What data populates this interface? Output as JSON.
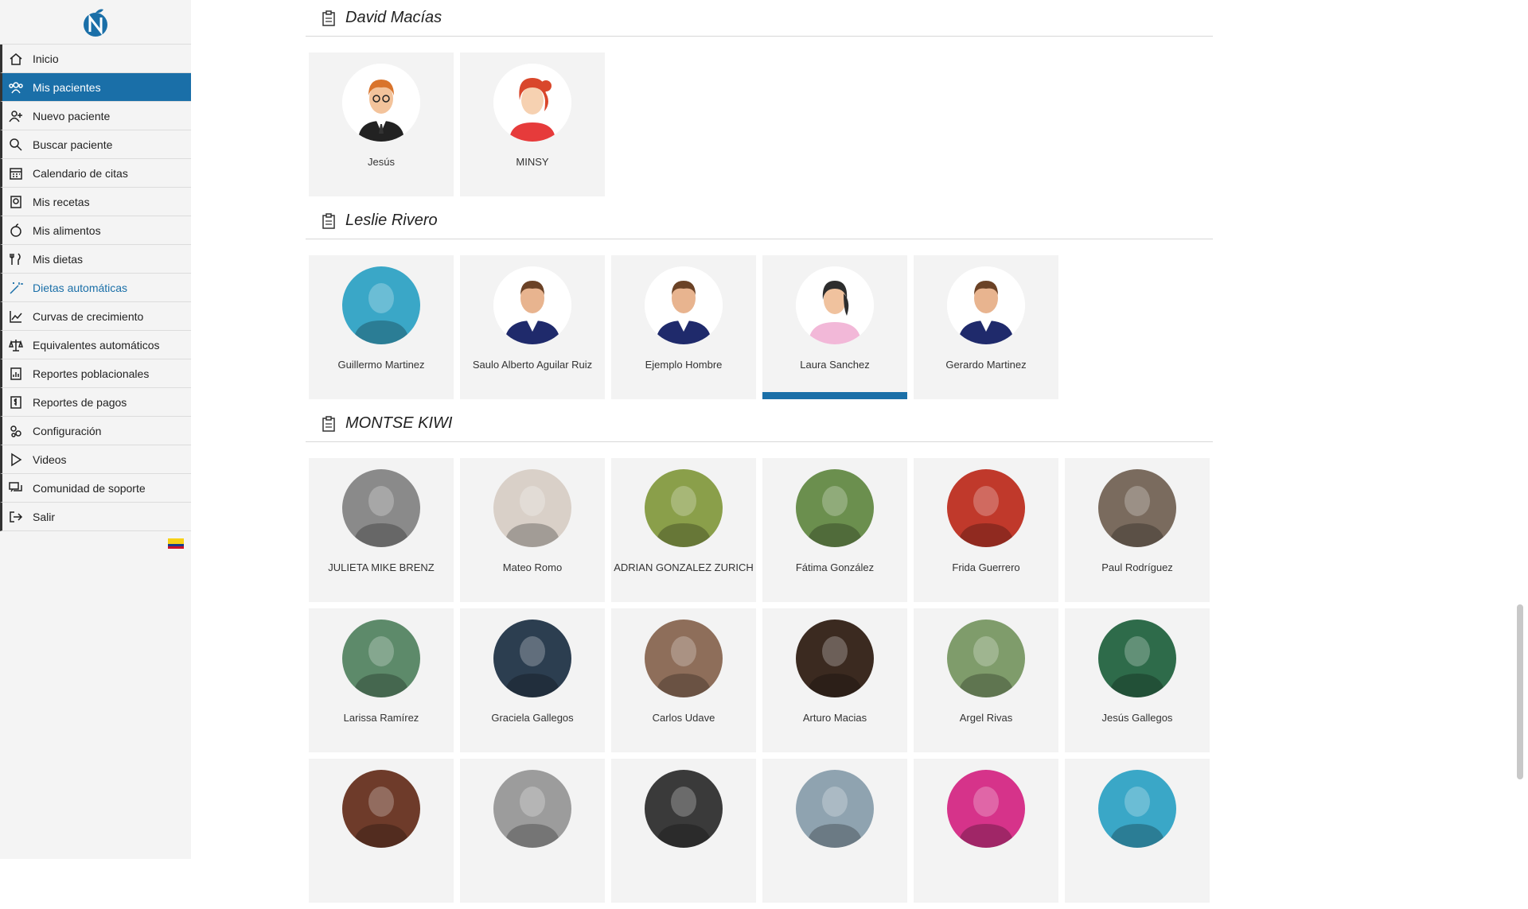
{
  "sidebar": {
    "items": [
      {
        "label": "Inicio",
        "icon": "home-icon"
      },
      {
        "label": "Mis pacientes",
        "icon": "users-icon",
        "active": true
      },
      {
        "label": "Nuevo paciente",
        "icon": "add-user-icon"
      },
      {
        "label": "Buscar paciente",
        "icon": "search-icon"
      },
      {
        "label": "Calendario de citas",
        "icon": "calendar-icon"
      },
      {
        "label": "Mis recetas",
        "icon": "recipe-icon"
      },
      {
        "label": "Mis alimentos",
        "icon": "apple-icon"
      },
      {
        "label": "Mis dietas",
        "icon": "cutlery-icon"
      },
      {
        "label": "Dietas automáticas",
        "icon": "magic-wand-icon",
        "highlight": true
      },
      {
        "label": "Curvas de crecimiento",
        "icon": "chart-icon"
      },
      {
        "label": "Equivalentes automáticos",
        "icon": "scale-icon"
      },
      {
        "label": "Reportes poblacionales",
        "icon": "report-icon"
      },
      {
        "label": "Reportes de pagos",
        "icon": "payment-report-icon"
      },
      {
        "label": "Configuración",
        "icon": "gears-icon"
      },
      {
        "label": "Videos",
        "icon": "play-icon"
      },
      {
        "label": "Comunidad de soporte",
        "icon": "chat-icon"
      },
      {
        "label": "Salir",
        "icon": "logout-icon"
      }
    ],
    "flag": "colombia-flag",
    "colors": {
      "active": "#1a6fa8"
    }
  },
  "sections": [
    {
      "title": "David Macías",
      "patients": [
        {
          "name": "Jesús",
          "avatar": "man-glasses"
        },
        {
          "name": "MINSY",
          "avatar": "woman-redhair"
        }
      ]
    },
    {
      "title": "Leslie Rivero",
      "patients": [
        {
          "name": "Guillermo Martinez",
          "avatar": "photo"
        },
        {
          "name": "Saulo Alberto Aguilar Ruiz",
          "avatar": "man-default"
        },
        {
          "name": "Ejemplo Hombre",
          "avatar": "man-default"
        },
        {
          "name": "Laura Sanchez",
          "avatar": "woman-default",
          "selected": true
        },
        {
          "name": "Gerardo Martinez",
          "avatar": "man-default"
        }
      ]
    },
    {
      "title": "MONTSE KIWI",
      "patients": [
        {
          "name": "JULIETA MIKE BRENZ",
          "avatar": "photo"
        },
        {
          "name": "Mateo Romo",
          "avatar": "photo"
        },
        {
          "name": "ADRIAN GONZALEZ ZURICH",
          "avatar": "photo"
        },
        {
          "name": "Fátima González",
          "avatar": "photo"
        },
        {
          "name": "Frida Guerrero",
          "avatar": "photo"
        },
        {
          "name": "Paul Rodríguez",
          "avatar": "photo"
        },
        {
          "name": "Larissa Ramírez",
          "avatar": "photo"
        },
        {
          "name": "Graciela Gallegos",
          "avatar": "photo"
        },
        {
          "name": "Carlos Udave",
          "avatar": "photo"
        },
        {
          "name": "Arturo Macias",
          "avatar": "photo"
        },
        {
          "name": "Argel Rivas",
          "avatar": "photo"
        },
        {
          "name": "Jesús Gallegos",
          "avatar": "photo"
        },
        {
          "name": "",
          "avatar": "photo"
        },
        {
          "name": "",
          "avatar": "photo"
        },
        {
          "name": "",
          "avatar": "photo"
        },
        {
          "name": "",
          "avatar": "photo"
        },
        {
          "name": "",
          "avatar": "photo"
        },
        {
          "name": "",
          "avatar": "photo"
        }
      ]
    }
  ]
}
